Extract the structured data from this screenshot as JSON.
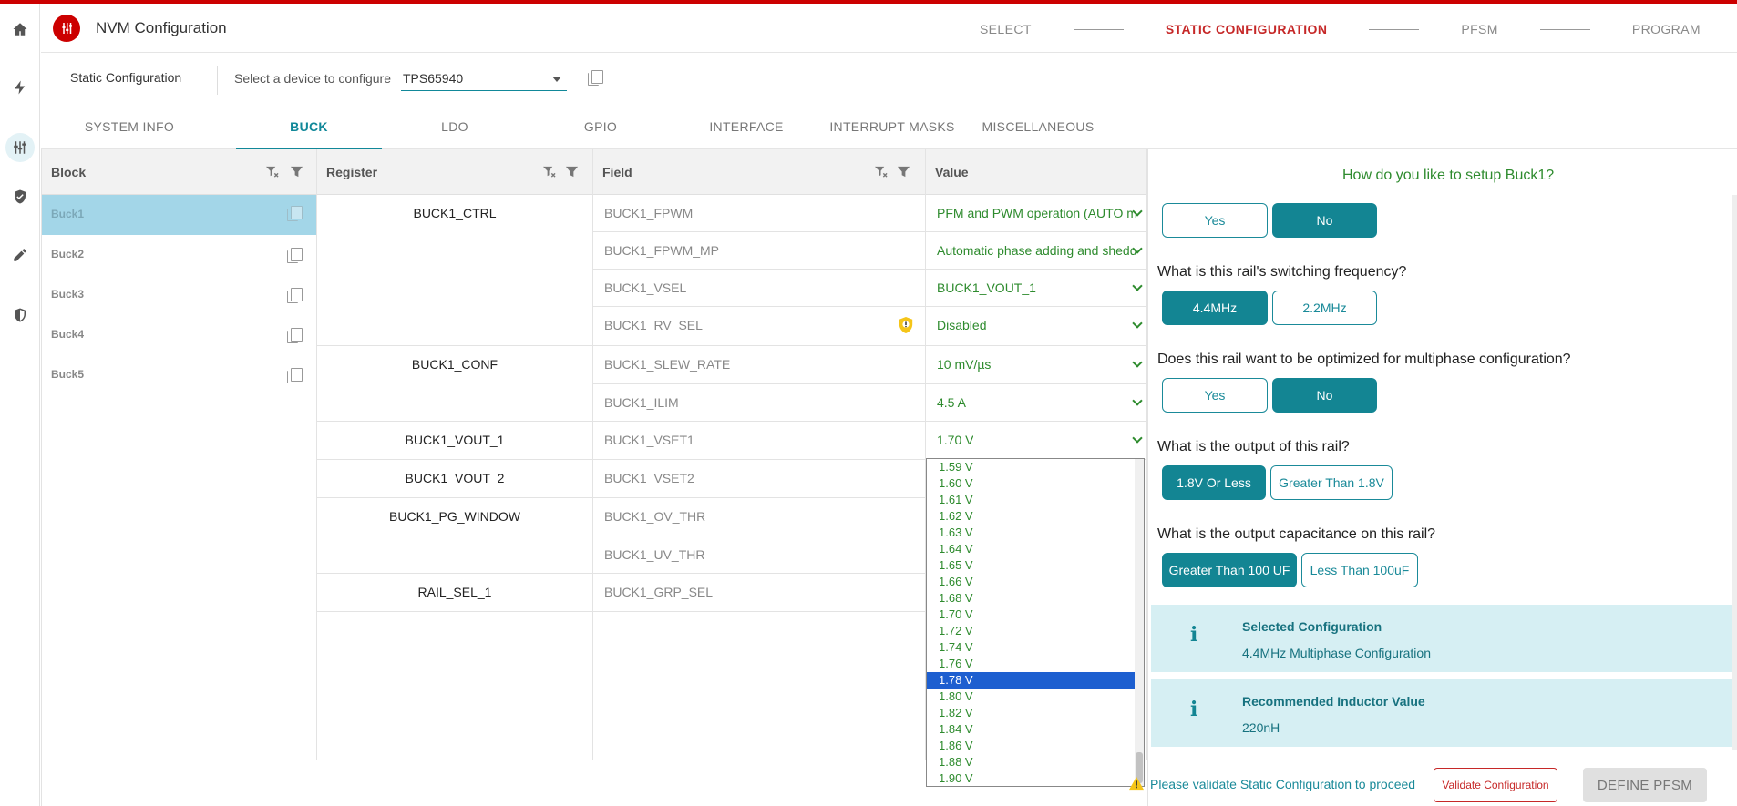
{
  "app": {
    "title": "NVM Configuration"
  },
  "steps": [
    "SELECT",
    "STATIC CONFIGURATION",
    "PFSM",
    "PROGRAM"
  ],
  "active_step": "STATIC CONFIGURATION",
  "device_row": {
    "section_label": "Static Configuration",
    "device_label": "Select a device to configure",
    "device_value": "TPS65940"
  },
  "tabs": [
    "SYSTEM INFO",
    "BUCK",
    "LDO",
    "GPIO",
    "INTERFACE",
    "INTERRUPT MASKS",
    "MISCELLANEOUS"
  ],
  "active_tab": "BUCK",
  "grid": {
    "headers": {
      "block": "Block",
      "register": "Register",
      "field": "Field",
      "value": "Value"
    },
    "blocks": [
      "Buck1",
      "Buck2",
      "Buck3",
      "Buck4",
      "Buck5"
    ],
    "selected_block": "Buck1",
    "registers": [
      "BUCK1_CTRL",
      "BUCK1_CONF",
      "BUCK1_VOUT_1",
      "BUCK1_VOUT_2",
      "BUCK1_PG_WINDOW",
      "RAIL_SEL_1"
    ],
    "fields": [
      "BUCK1_FPWM",
      "BUCK1_FPWM_MP",
      "BUCK1_VSEL",
      "BUCK1_RV_SEL",
      "BUCK1_SLEW_RATE",
      "BUCK1_ILIM",
      "BUCK1_VSET1",
      "BUCK1_VSET2",
      "BUCK1_OV_THR",
      "BUCK1_UV_THR",
      "BUCK1_GRP_SEL"
    ],
    "values": [
      "PFM and PWM operation (AUTO mode).",
      "Automatic phase adding and shedding.",
      "BUCK1_VOUT_1",
      "Disabled",
      "10 mV/µs",
      "4.5 A",
      "1.70 V"
    ]
  },
  "dropdown": {
    "options": [
      "1.59 V",
      "1.60 V",
      "1.61 V",
      "1.62 V",
      "1.63 V",
      "1.64 V",
      "1.65 V",
      "1.66 V",
      "1.68 V",
      "1.70 V",
      "1.72 V",
      "1.74 V",
      "1.76 V",
      "1.78 V",
      "1.80 V",
      "1.82 V",
      "1.84 V",
      "1.86 V",
      "1.88 V",
      "1.90 V"
    ],
    "selected": "1.78 V"
  },
  "panel": {
    "header_question": "How do you like to setup Buck1?",
    "questions": [
      {
        "text": "",
        "options": [
          "Yes",
          "No"
        ],
        "selected": "No"
      },
      {
        "text": "What is this rail's switching frequency?",
        "options": [
          "4.4MHz",
          "2.2MHz"
        ],
        "selected": "4.4MHz"
      },
      {
        "text": "Does this rail want to be optimized for multiphase configuration?",
        "options": [
          "Yes",
          "No"
        ],
        "selected": "No"
      },
      {
        "text": "What is the output of this rail?",
        "options": [
          "1.8V Or Less",
          "Greater Than 1.8V"
        ],
        "selected": "1.8V Or Less"
      },
      {
        "text": "What is the output capacitance on this rail?",
        "options": [
          "Greater Than 100 UF",
          "Less Than 100uF"
        ],
        "selected": "Greater Than 100 UF"
      }
    ],
    "info_cards": [
      {
        "title": "Selected Configuration",
        "value": "4.4MHz Multiphase Configuration"
      },
      {
        "title": "Recommended Inductor Value",
        "value": "220nH"
      }
    ]
  },
  "footer": {
    "warning": "Please validate Static Configuration to proceed",
    "validate_button": "Validate Configuration",
    "next_button": "DEFINE PFSM"
  }
}
